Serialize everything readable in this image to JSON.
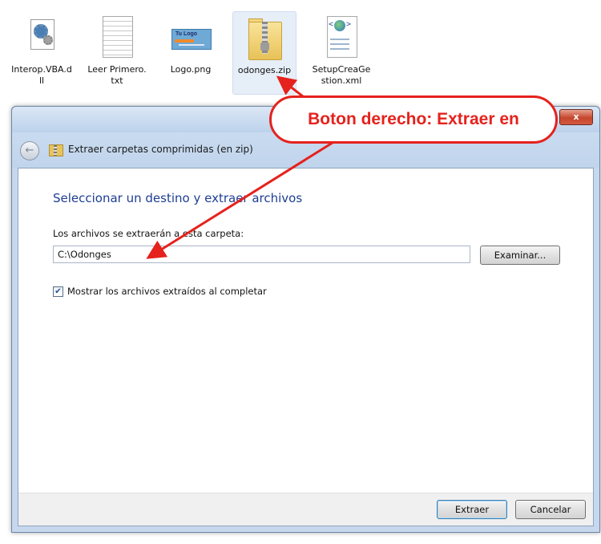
{
  "files": [
    {
      "name": "Interop.VBA.dll",
      "icon": "dll-file-icon"
    },
    {
      "name": "Leer Primero.txt",
      "icon": "text-file-icon"
    },
    {
      "name": "Logo.png",
      "icon": "image-file-icon",
      "thumbnail_text": "Tu Logo"
    },
    {
      "name": "odonges.zip",
      "icon": "zip-folder-icon",
      "selected": true
    },
    {
      "name": "SetupCreaGestion.xml",
      "icon": "xml-file-icon"
    }
  ],
  "annotation": {
    "text": "Boton derecho: Extraer en",
    "color": "#e5221d"
  },
  "dialog": {
    "close_label": "x",
    "nav_title": "Extraer carpetas comprimidas (en zip)",
    "heading": "Seleccionar un destino y extraer archivos",
    "destination_label": "Los archivos se extraerán a esta carpeta:",
    "destination_value": "C:\\Odonges",
    "browse_label": "Examinar...",
    "show_files_label": "Mostrar los archivos extraídos al completar",
    "show_files_checked": true,
    "extract_label": "Extraer",
    "cancel_label": "Cancelar",
    "heading_color": "#1e3e93"
  }
}
